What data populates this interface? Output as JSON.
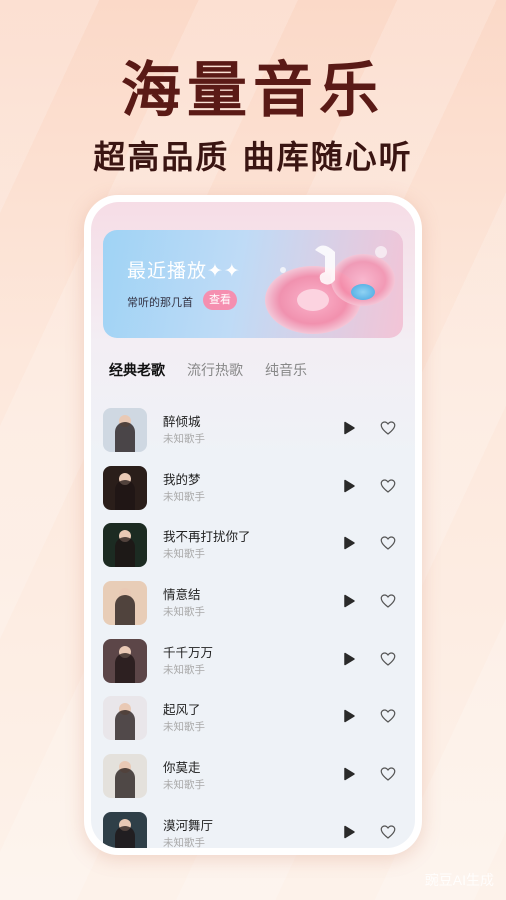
{
  "headline": "海量音乐",
  "subline": "超高品质 曲库随心听",
  "banner": {
    "title": "最近播放✦✦",
    "subtitle": "常听的那几首",
    "button": "查看"
  },
  "tabs": [
    {
      "label": "经典老歌",
      "active": true
    },
    {
      "label": "流行热歌",
      "active": false
    },
    {
      "label": "纯音乐",
      "active": false
    }
  ],
  "songs": [
    {
      "title": "醉倾城",
      "artist": "未知歌手",
      "thumb_color": "#cfd8e2"
    },
    {
      "title": "我的梦",
      "artist": "未知歌手",
      "thumb_color": "#2a1e1a"
    },
    {
      "title": "我不再打扰你了",
      "artist": "未知歌手",
      "thumb_color": "#1c2b22"
    },
    {
      "title": "情意结",
      "artist": "未知歌手",
      "thumb_color": "#e8cdb7"
    },
    {
      "title": "千千万万",
      "artist": "未知歌手",
      "thumb_color": "#5c4648"
    },
    {
      "title": "起风了",
      "artist": "未知歌手",
      "thumb_color": "#e9e6ea"
    },
    {
      "title": "你莫走",
      "artist": "未知歌手",
      "thumb_color": "#e4e1dc"
    },
    {
      "title": "漠河舞厅",
      "artist": "未知歌手",
      "thumb_color": "#2f3f48"
    }
  ],
  "watermark": "豌豆AI生成"
}
